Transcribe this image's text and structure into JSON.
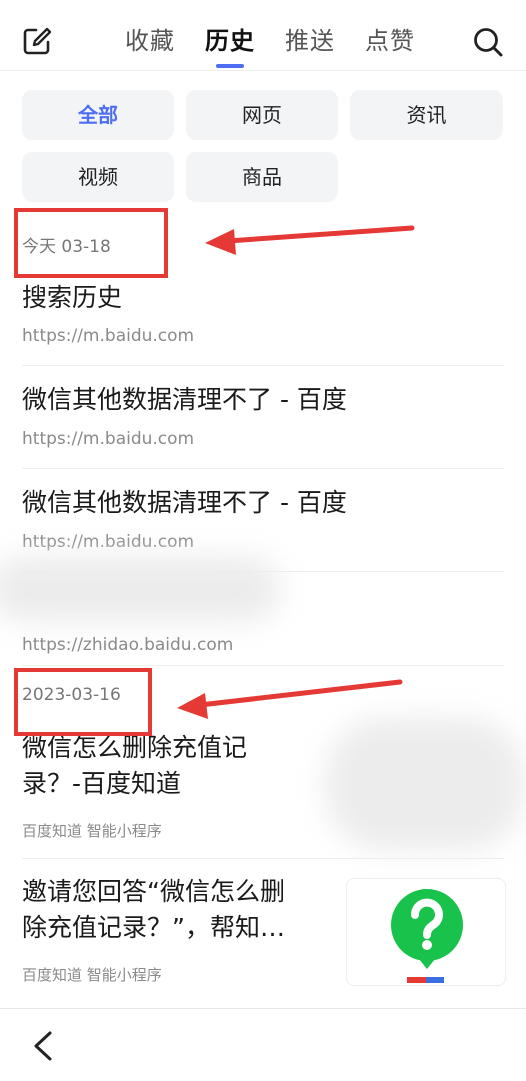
{
  "topbar": {
    "tabs": [
      {
        "label": "收藏",
        "active": false
      },
      {
        "label": "历史",
        "active": true
      },
      {
        "label": "推送",
        "active": false
      },
      {
        "label": "点赞",
        "active": false
      }
    ],
    "icons": [
      "edit-icon",
      "search-icon"
    ]
  },
  "filters": [
    {
      "label": "全部",
      "active": true
    },
    {
      "label": "网页",
      "active": false
    },
    {
      "label": "资讯",
      "active": false
    },
    {
      "label": "视频",
      "active": false
    },
    {
      "label": "商品",
      "active": false
    }
  ],
  "sections": [
    {
      "date": "今天  03-18",
      "items": [
        {
          "title": "搜索历史",
          "url": "https://m.baidu.com"
        },
        {
          "title": "微信其他数据清理不了 - 百度",
          "url": "https://m.baidu.com"
        },
        {
          "title": "微信其他数据清理不了 - 百度",
          "url": "https://m.baidu.com"
        },
        {
          "title": "",
          "url": "https://zhidao.baidu.com"
        }
      ]
    },
    {
      "date": "2023-03-16",
      "items": [
        {
          "title_line1": "微信怎么删除充值记",
          "title_line2": "录？-百度知道",
          "source": "百度知道 智能小程序"
        },
        {
          "title_line1": "邀请您回答“微信怎么删",
          "title_line2": "除充值记录？”，帮知…",
          "source": "百度知道 智能小程序",
          "thumbnail": "question-mark-icon"
        }
      ]
    }
  ],
  "colors": {
    "accent": "#4e6ef2",
    "annotation": "#e53935",
    "thumbnail_green": "#19c24a"
  }
}
